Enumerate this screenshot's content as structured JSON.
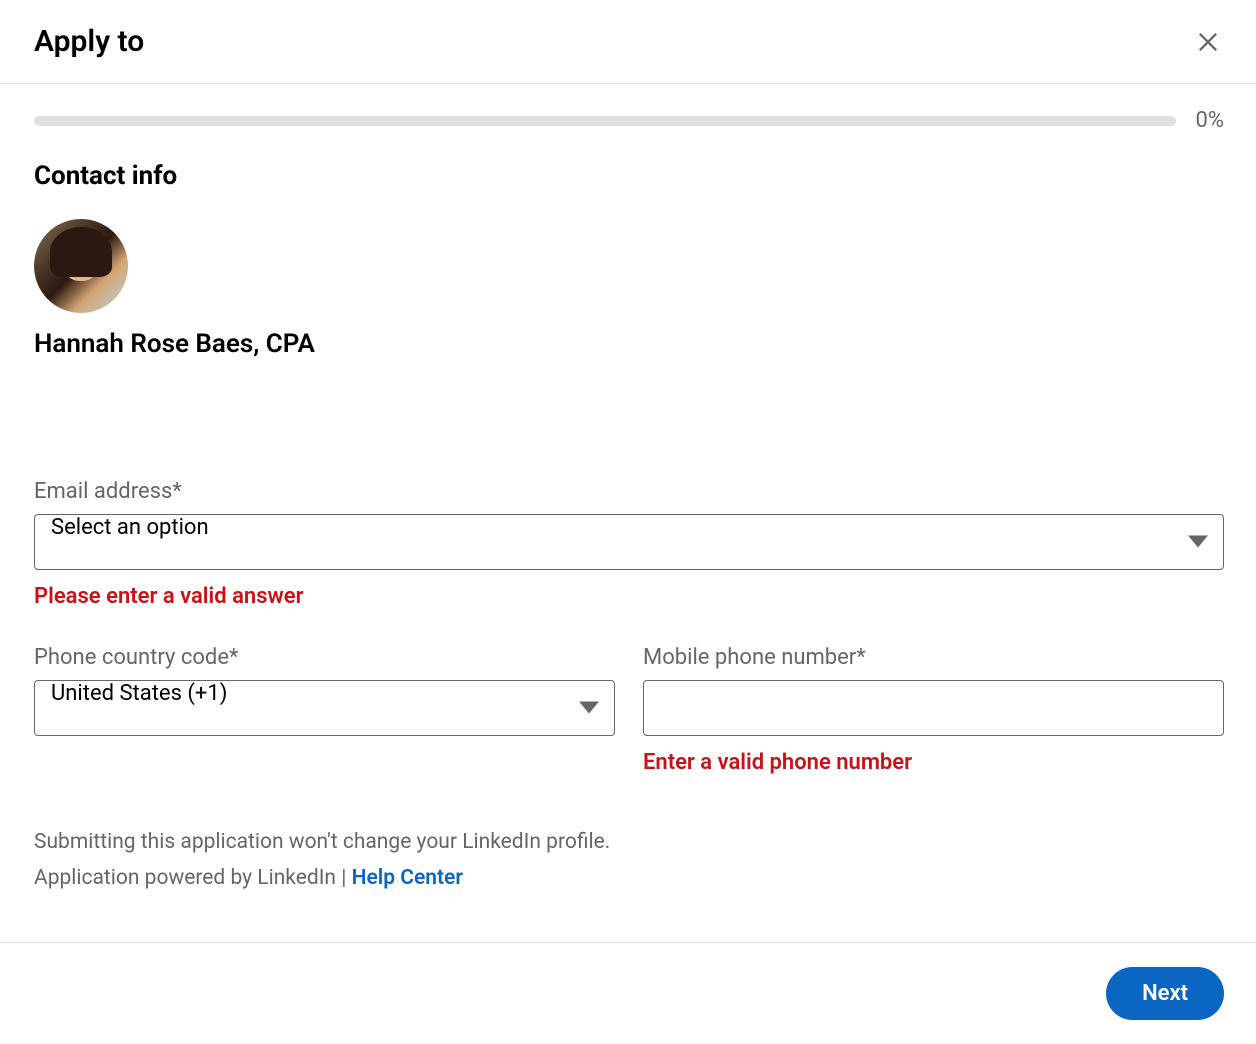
{
  "header": {
    "title": "Apply to"
  },
  "progress": {
    "percent_text": "0%"
  },
  "section": {
    "title": "Contact info"
  },
  "user": {
    "name": "Hannah Rose Baes, CPA"
  },
  "form": {
    "email": {
      "label": "Email address*",
      "selected": "Select an option",
      "error": "Please enter a valid answer"
    },
    "country_code": {
      "label": "Phone country code*",
      "selected": "United States (+1)"
    },
    "phone": {
      "label": "Mobile phone number*",
      "value": "",
      "error": "Enter a valid phone number"
    }
  },
  "footer": {
    "line1": "Submitting this application won't change your LinkedIn profile.",
    "line2_prefix": "Application powered by LinkedIn | ",
    "help_link": "Help Center"
  },
  "actions": {
    "next": "Next"
  }
}
